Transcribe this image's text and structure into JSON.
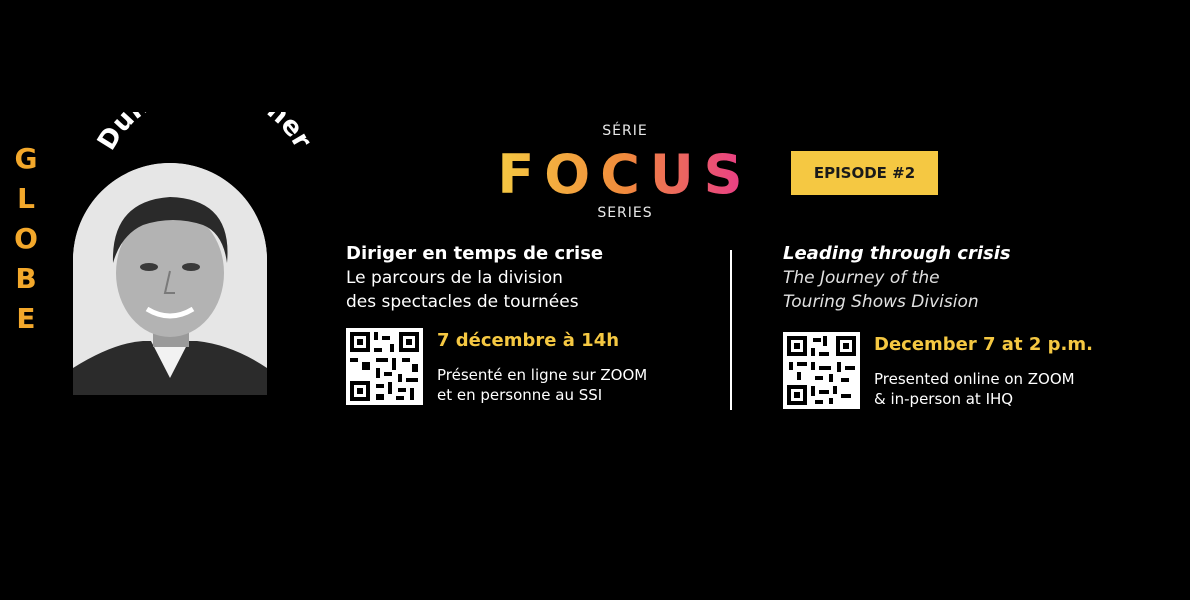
{
  "speaker": {
    "name": "Duncan J Fisher",
    "photo_icon": "portrait-photo-icon"
  },
  "side_label": {
    "letters": [
      "G",
      "L",
      "O",
      "B",
      "E"
    ],
    "color": "#f3a82b"
  },
  "brand": {
    "serie_label": "SÉRIE",
    "focus_word": "FOCUS",
    "series_label": "SERIES",
    "gradient": [
      "#f5c842",
      "#f08a3c",
      "#e8388c"
    ]
  },
  "episode": {
    "label": "EPISODE #2",
    "color": "#f5c842"
  },
  "french": {
    "title": "Diriger en temps de crise",
    "subtitle_line1": "Le parcours de la division",
    "subtitle_line2": "des spectacles de tournées",
    "date": "7 décembre à 14h",
    "venue_line1": "Présenté en ligne sur ZOOM",
    "venue_line2": "et en personne au SSI",
    "qr_icon": "qr-code-icon"
  },
  "english": {
    "title": "Leading through crisis",
    "subtitle_line1": "The Journey of the",
    "subtitle_line2": "Touring Shows Division",
    "date": "December 7 at 2 p.m.",
    "venue_line1": "Presented online on ZOOM",
    "venue_line2": "& in-person at IHQ",
    "qr_icon": "qr-code-icon"
  },
  "colors": {
    "background": "#000000",
    "accent": "#f5c842"
  }
}
